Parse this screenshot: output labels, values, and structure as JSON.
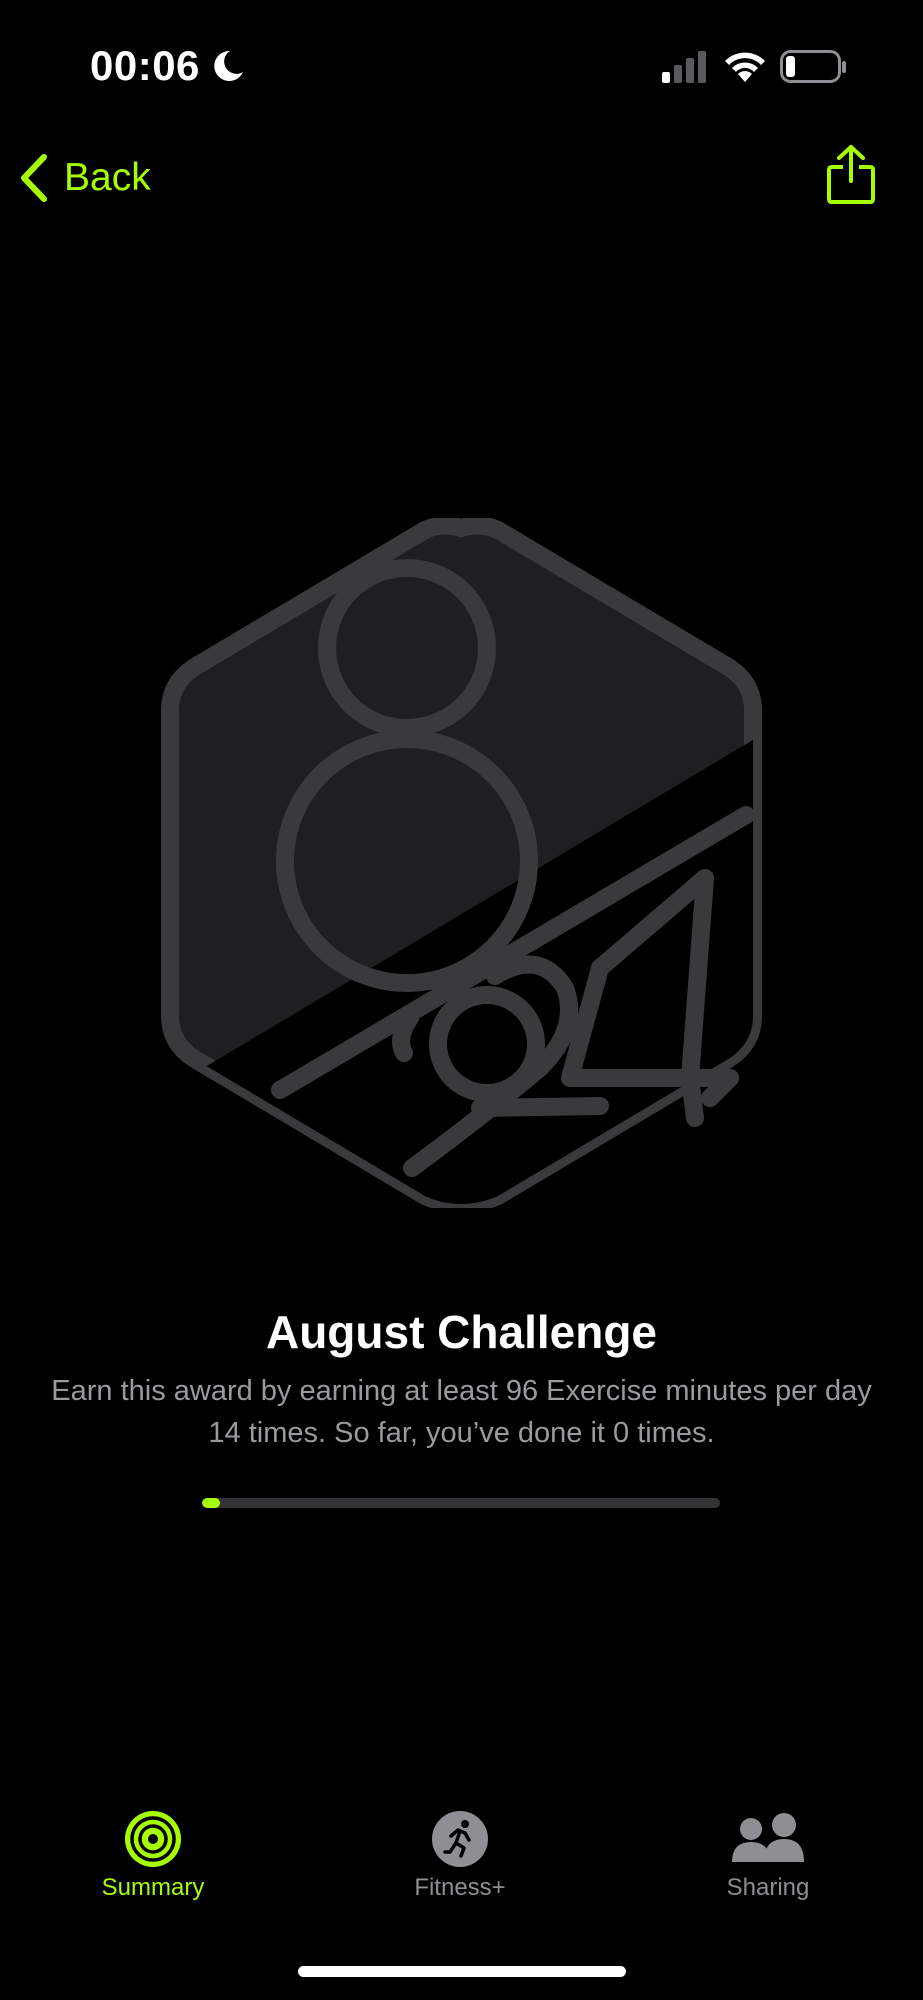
{
  "status_bar": {
    "time": "00:06",
    "icons": [
      "moon-icon",
      "signal-icon",
      "wifi-icon",
      "battery-icon"
    ]
  },
  "nav": {
    "back_label": "Back",
    "share_icon": "share-icon"
  },
  "award": {
    "badge_icon": "august-2024-badge",
    "title": "August Challenge",
    "description": "Earn this award by earning at least 96 Exercise minutes per day 14 times. So far, you’ve done it 0 times.",
    "progress_fraction": 0
  },
  "tabs": [
    {
      "label": "Summary",
      "icon": "activity-rings-icon",
      "active": true
    },
    {
      "label": "Fitness+",
      "icon": "running-figure-icon",
      "active": false
    },
    {
      "label": "Sharing",
      "icon": "people-icon",
      "active": false
    }
  ],
  "colors": {
    "accent": "#a6ff00",
    "background": "#000000",
    "muted_text": "#9a9a9f",
    "badge_fill": "#1f1f21",
    "badge_stroke": "#3a3a3c"
  }
}
